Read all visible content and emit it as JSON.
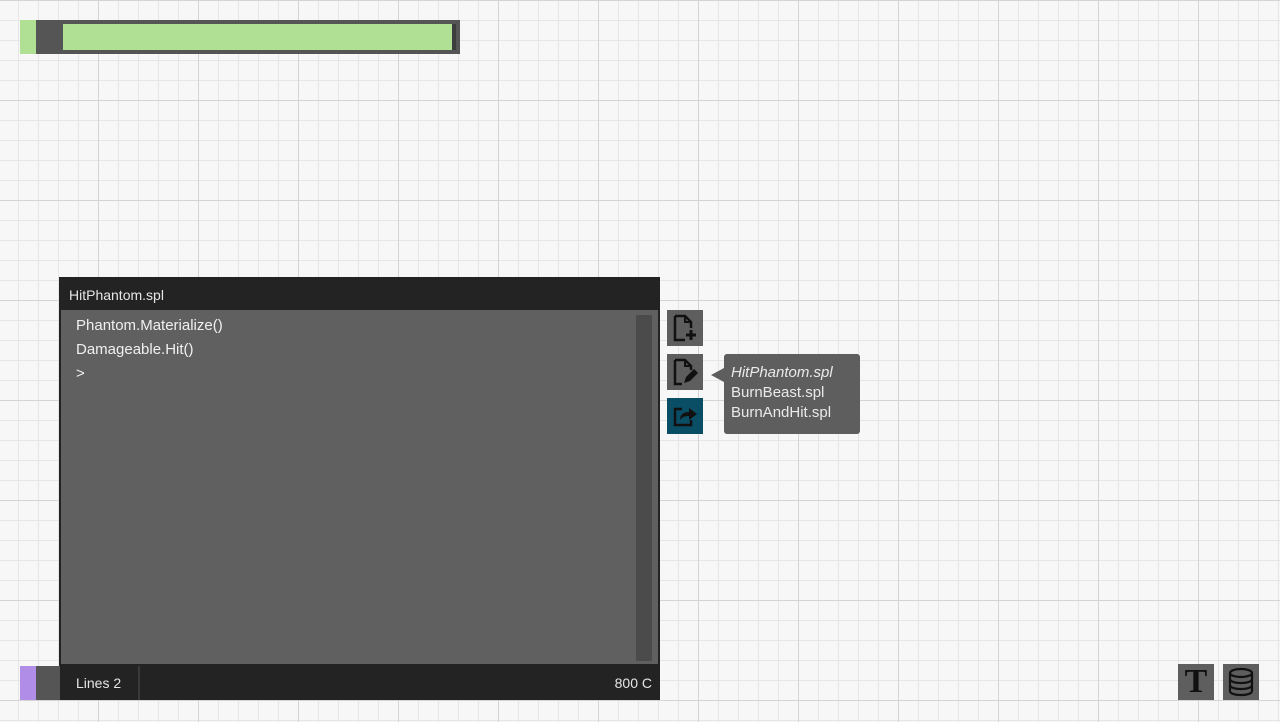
{
  "top_bar": {
    "swatch_color": "#b0e094",
    "fill_color": "#b0e094",
    "fill_fraction": 0.99
  },
  "editor": {
    "filename": "HitPhantom.spl",
    "code_lines": [
      "Phantom.Materialize()",
      "Damageable.Hit()",
      ">"
    ]
  },
  "status": {
    "swatch_color": "#b08ee8",
    "lines_label": "Lines 2",
    "cost_label": "800 C"
  },
  "tools": {
    "new_file_icon": "file-plus-icon",
    "edit_file_icon": "file-edit-icon",
    "export_icon": "export-share-icon",
    "active_color": "#0a4e66"
  },
  "file_list": [
    "HitPhantom.spl",
    "BurnBeast.spl",
    "BurnAndHit.spl"
  ],
  "corner_buttons": {
    "text_mode_glyph": "T",
    "text_mode_icon": "text-mode-icon",
    "database_icon": "database-icon"
  }
}
